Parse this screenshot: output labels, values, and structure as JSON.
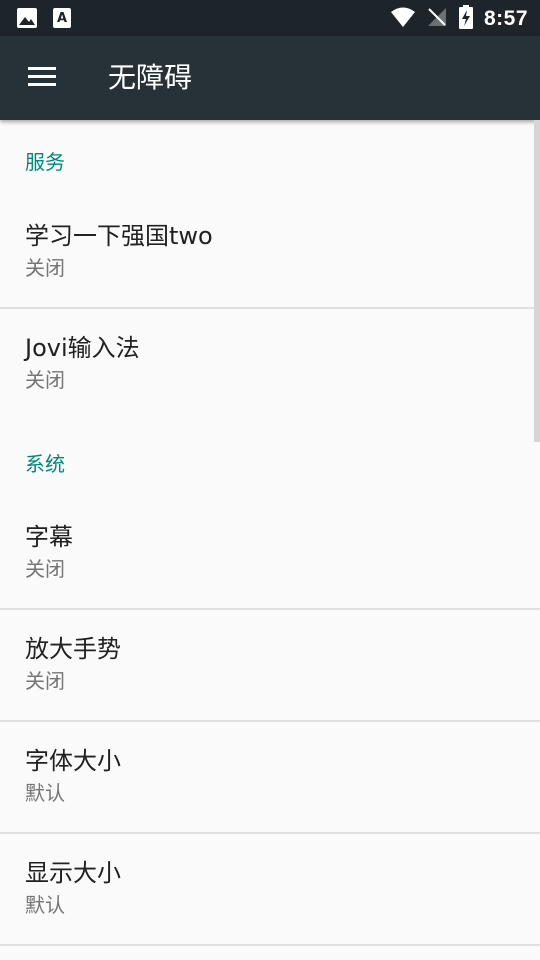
{
  "status_bar": {
    "time": "8:57",
    "left_icons": [
      "image-icon",
      "text-a-icon"
    ],
    "right_icons": [
      "wifi-icon",
      "no-signal-icon",
      "battery-charging-icon"
    ]
  },
  "toolbar": {
    "title": "无障碍",
    "menu_icon": "menu-icon",
    "background": "#263238"
  },
  "accent_color": "#00897b",
  "sections": [
    {
      "title": "服务",
      "items": [
        {
          "title": "学习一下强国two",
          "summary": "关闭"
        },
        {
          "title": "Jovi输入法",
          "summary": "关闭"
        }
      ]
    },
    {
      "title": "系统",
      "items": [
        {
          "title": "字幕",
          "summary": "关闭"
        },
        {
          "title": "放大手势",
          "summary": "关闭"
        },
        {
          "title": "字体大小",
          "summary": "默认"
        },
        {
          "title": "显示大小",
          "summary": "默认"
        }
      ]
    }
  ]
}
